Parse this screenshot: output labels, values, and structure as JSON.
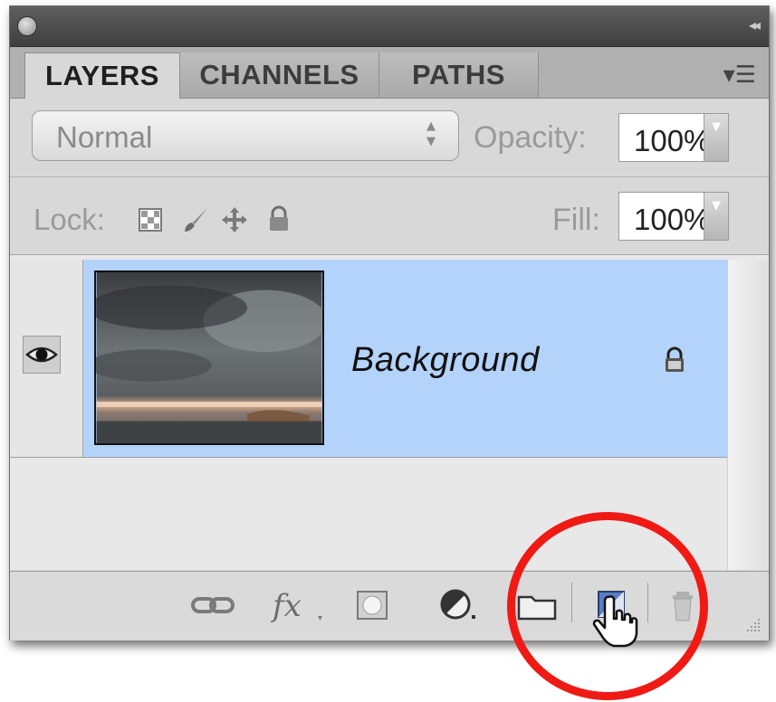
{
  "panel": {
    "tabs": [
      {
        "label": "LAYERS",
        "active": true
      },
      {
        "label": "CHANNELS",
        "active": false
      },
      {
        "label": "PATHS",
        "active": false
      }
    ],
    "menu_icon": "panel-menu-icon",
    "collapse_icon": "collapse-arrows-icon"
  },
  "blend": {
    "mode": "Normal",
    "opacity_label": "Opacity:",
    "opacity_value": "100%"
  },
  "lock": {
    "label": "Lock:",
    "icons": [
      "lock-transparent-pixels-icon",
      "lock-image-pixels-icon",
      "lock-position-icon",
      "lock-all-icon"
    ],
    "fill_label": "Fill:",
    "fill_value": "100%"
  },
  "layers": [
    {
      "name": "Background",
      "visible": true,
      "locked": true,
      "selected": true
    }
  ],
  "bottom_buttons": [
    "link-layers-icon",
    "add-layer-style-icon",
    "add-layer-mask-icon",
    "new-adjustment-layer-icon",
    "new-group-icon",
    "new-layer-icon",
    "delete-layer-icon"
  ],
  "highlight": {
    "target": "new-layer-button",
    "color": "#f01a15"
  },
  "colors": {
    "selected_row": "#b4d3fb",
    "panel_bg": "#d8d8d8"
  }
}
